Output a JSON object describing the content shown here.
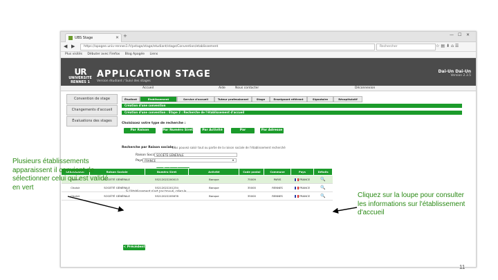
{
  "browser": {
    "tab_title": "UBS Stage",
    "url": "https://apogee.univ-rennes1.fr/pstage/stage/etudiant/stage/Convention/etablissement",
    "search_placeholder": "Rechercher",
    "bookmarks": [
      "Plus visités",
      "Débuter avec Firefox",
      "Blog Apogée",
      "Liens"
    ]
  },
  "app": {
    "logo_mark": "UR",
    "logo_text_1": "UNIVERSITÉ",
    "logo_text_2": "RENNES 1",
    "title": "APPLICATION STAGE",
    "subtitle": "Version étudiant / Suivi des stages",
    "user_name": "Dai-Un Dai-Un",
    "version": "Version 2.3.5",
    "menu": [
      "Accueil",
      "Aide",
      "Nous contacter",
      "Déconnexion"
    ]
  },
  "sidebar": {
    "items": [
      "Convention de stage",
      "Changements d'accueil",
      "Évaluations des stages"
    ]
  },
  "tabs": [
    "Étudiant",
    "Établissement",
    "Service d'accueil",
    "Tuteur professionnel",
    "Stage",
    "Enseignant référent",
    "Signataire",
    "Récapitulatif"
  ],
  "form": {
    "bar1": "Création d'une convention",
    "bar2": "Création d'une convention : Étape 2 : Recherche de l'établissement d'accueil",
    "choose_label": "Choisissez votre type de recherche :",
    "search_types": [
      "Par Raison Sociale",
      "Par Numéro Siret",
      "Par Activité",
      "Par Siret/Siren",
      "Par Adresse"
    ],
    "rs_label": "Recherche par Raison sociale :",
    "rs_help": "Vous pouvez saisir tout ou partie de la raison sociale de l'établissement recherché",
    "rs_field_label": "Raison Sociale :",
    "rs_value": "SOCIÉTÉ GÉNÉRALE",
    "pays_label": "Pays :",
    "pays_value": "FRANCE",
    "search_button": "Rechercher",
    "results_label": "Établissement(s) trouvé(s) : 3",
    "create_link": "Si l'établissement n'est pas trouvé, créez-le",
    "prev_button": "< Précédent"
  },
  "results": {
    "headers": [
      "Sélectionner",
      "Raison Sociale",
      "Numéro Siret",
      "Activité",
      "Code postal",
      "Commune",
      "Pays",
      "Détails"
    ],
    "rows": [
      {
        "select": "Choisir",
        "name": "SOCIÉTÉ GÉNÉRALE",
        "siret": "55212022200013",
        "activity": "Banque",
        "cp": "75009",
        "commune": "PARIS",
        "pays": "FRANCE"
      },
      {
        "select": "Choisir",
        "name": "SOCIÉTÉ GÉNÉRALE",
        "siret": "55212022201234",
        "activity": "Banque",
        "cp": "35000",
        "commune": "RENNES",
        "pays": "FRANCE"
      },
      {
        "select": "Choisir",
        "name": "SOCIÉTÉ GÉNÉRALE",
        "siret": "55212022205678",
        "activity": "Banque",
        "cp": "35000",
        "commune": "RENNES",
        "pays": "FRANCE"
      }
    ]
  },
  "annotations": {
    "left": "Plusieurs établissements apparaissent il convient de sélectionner celui qui est validé en vert",
    "right": "Cliquez sur la loupe pour consulter les informations sur l'établissement d'accueil"
  },
  "page_number": "11",
  "colors": {
    "accent_green": "#1b9b2b",
    "annotation_green": "#2b8a16",
    "header_gray": "#4b4b4b"
  }
}
